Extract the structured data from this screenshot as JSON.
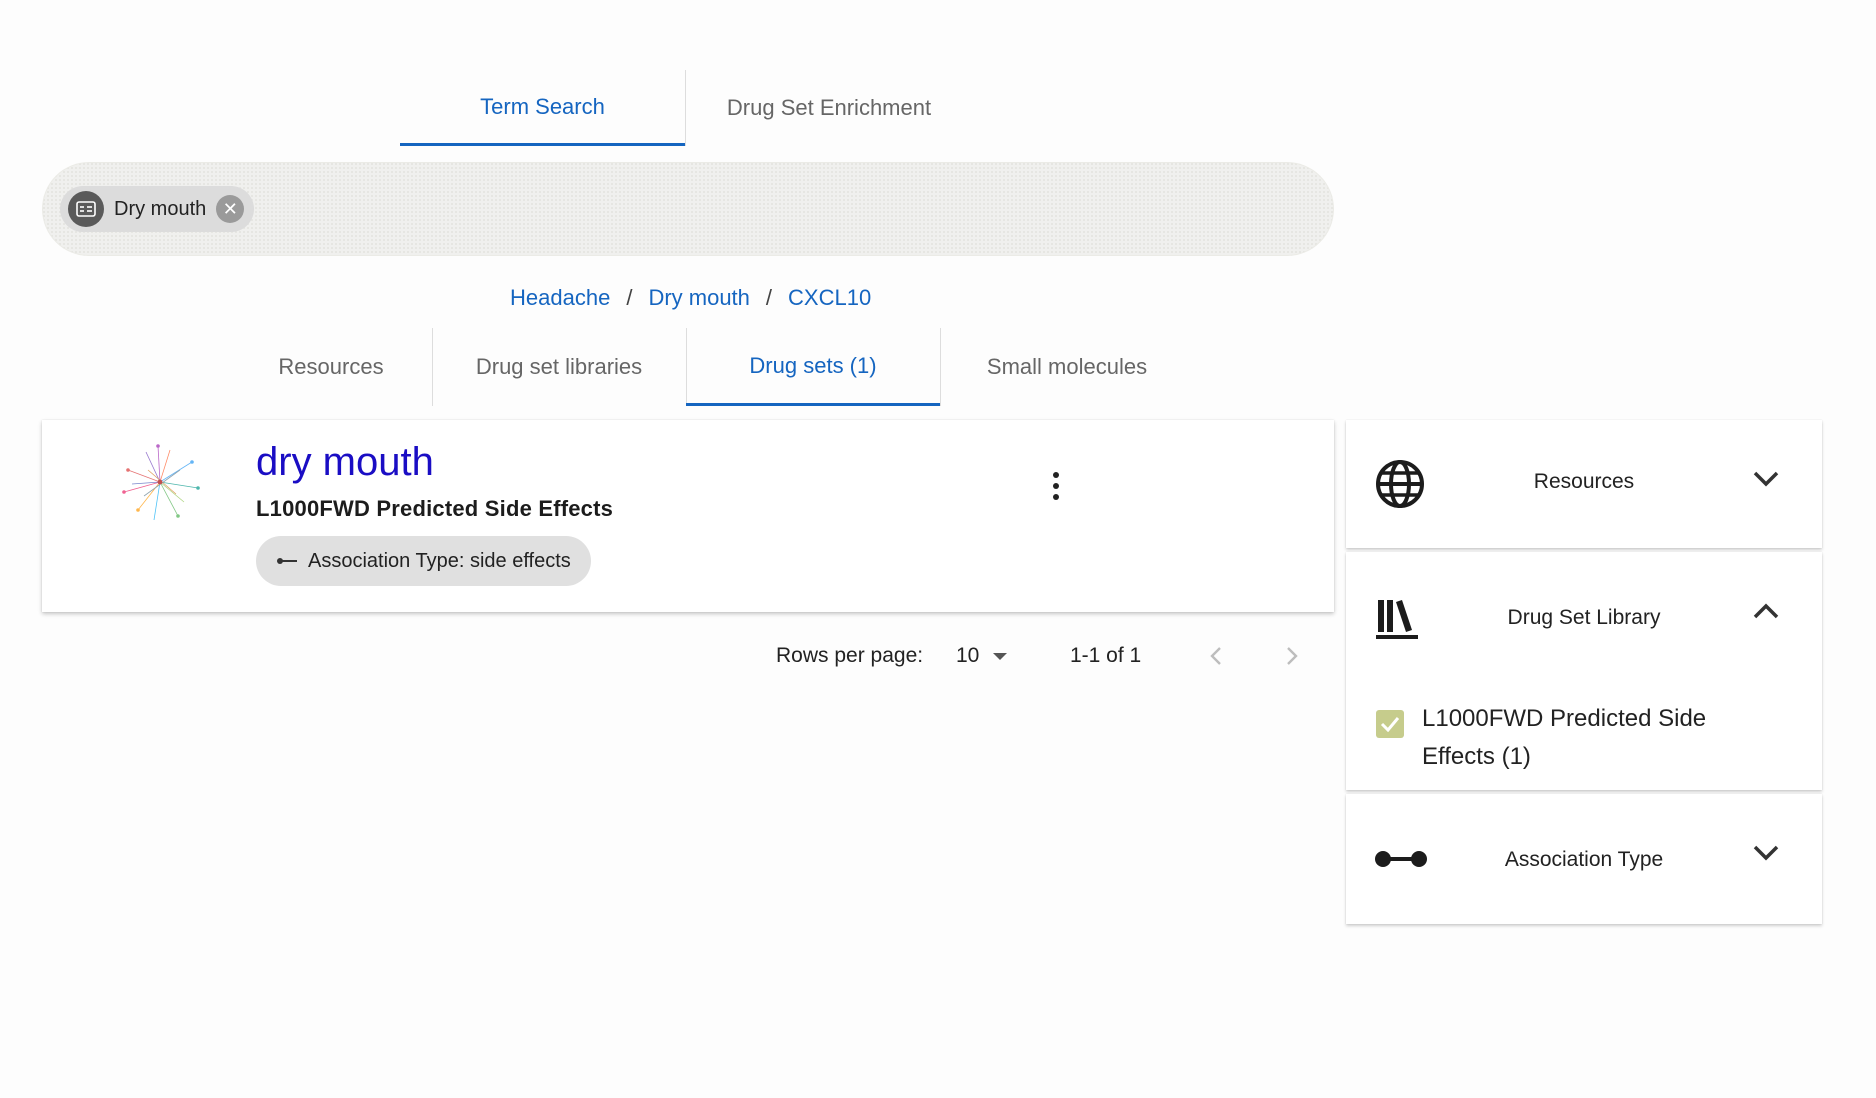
{
  "top_tabs": {
    "term_search": "Term Search",
    "drug_set_enrichment": "Drug Set Enrichment"
  },
  "search": {
    "chip_label": "Dry mouth",
    "chip_icon": "term-icon",
    "delete_icon": "cancel-icon"
  },
  "breadcrumb": {
    "items": [
      "Headache",
      "Dry mouth",
      "CXCL10"
    ],
    "separator": "/"
  },
  "sub_tabs": {
    "resources": "Resources",
    "drug_set_libraries": "Drug set libraries",
    "drug_sets": "Drug sets (1)",
    "small_molecules": "Small molecules"
  },
  "result": {
    "title": "dry mouth",
    "library": "L1000FWD Predicted Side Effects",
    "association_chip": "Association Type: side effects",
    "menu_icon": "more-vert-icon"
  },
  "pagination": {
    "rows_label": "Rows per page:",
    "rows_value": "10",
    "range": "1-1 of 1"
  },
  "sidebar": {
    "resources": "Resources",
    "drug_set_library": "Drug Set Library",
    "filter_label": "L1000FWD Predicted Side Effects (1)",
    "filter_checked": true,
    "association_type": "Association Type"
  },
  "colors": {
    "accent": "#1565c0",
    "title_link": "#1a0dc4",
    "checkbox": "#c6cc8c"
  }
}
